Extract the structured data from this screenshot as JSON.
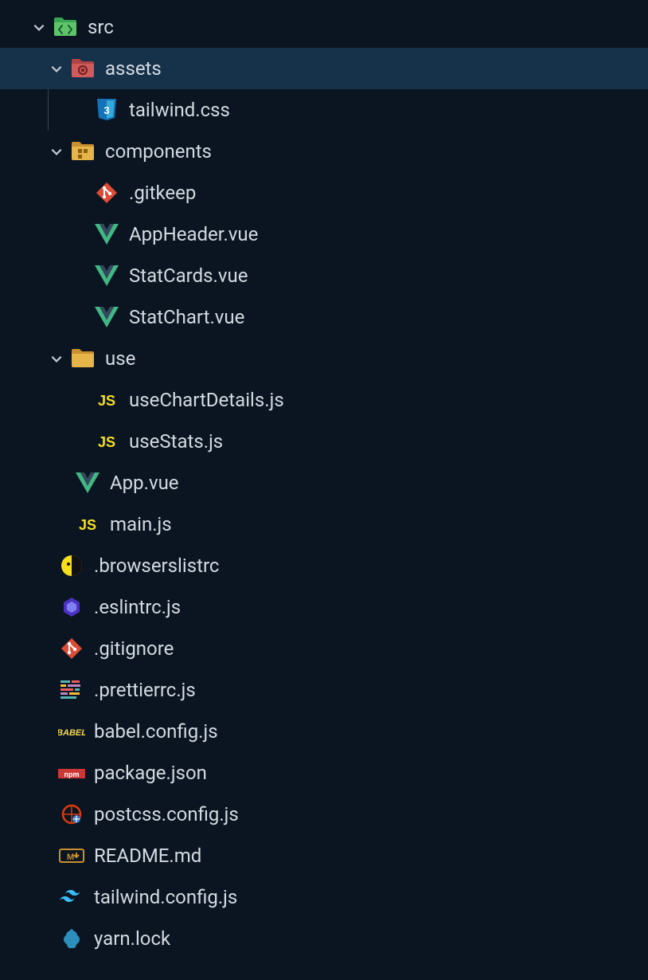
{
  "tree": {
    "src": {
      "label": "src",
      "assets": {
        "label": "assets",
        "tailwind_css": "tailwind.css"
      },
      "components": {
        "label": "components",
        "gitkeep": ".gitkeep",
        "app_header": "AppHeader.vue",
        "stat_cards": "StatCards.vue",
        "stat_chart": "StatChart.vue"
      },
      "use": {
        "label": "use",
        "use_chart_details": "useChartDetails.js",
        "use_stats": "useStats.js"
      },
      "app_vue": "App.vue",
      "main_js": "main.js"
    },
    "browserslistrc": ".browserslistrc",
    "eslintrc": ".eslintrc.js",
    "gitignore": ".gitignore",
    "prettierrc": ".prettierrc.js",
    "babel_config": "babel.config.js",
    "package_json": "package.json",
    "postcss_config": "postcss.config.js",
    "readme": "README.md",
    "tailwind_config": "tailwind.config.js",
    "yarn_lock": "yarn.lock"
  }
}
